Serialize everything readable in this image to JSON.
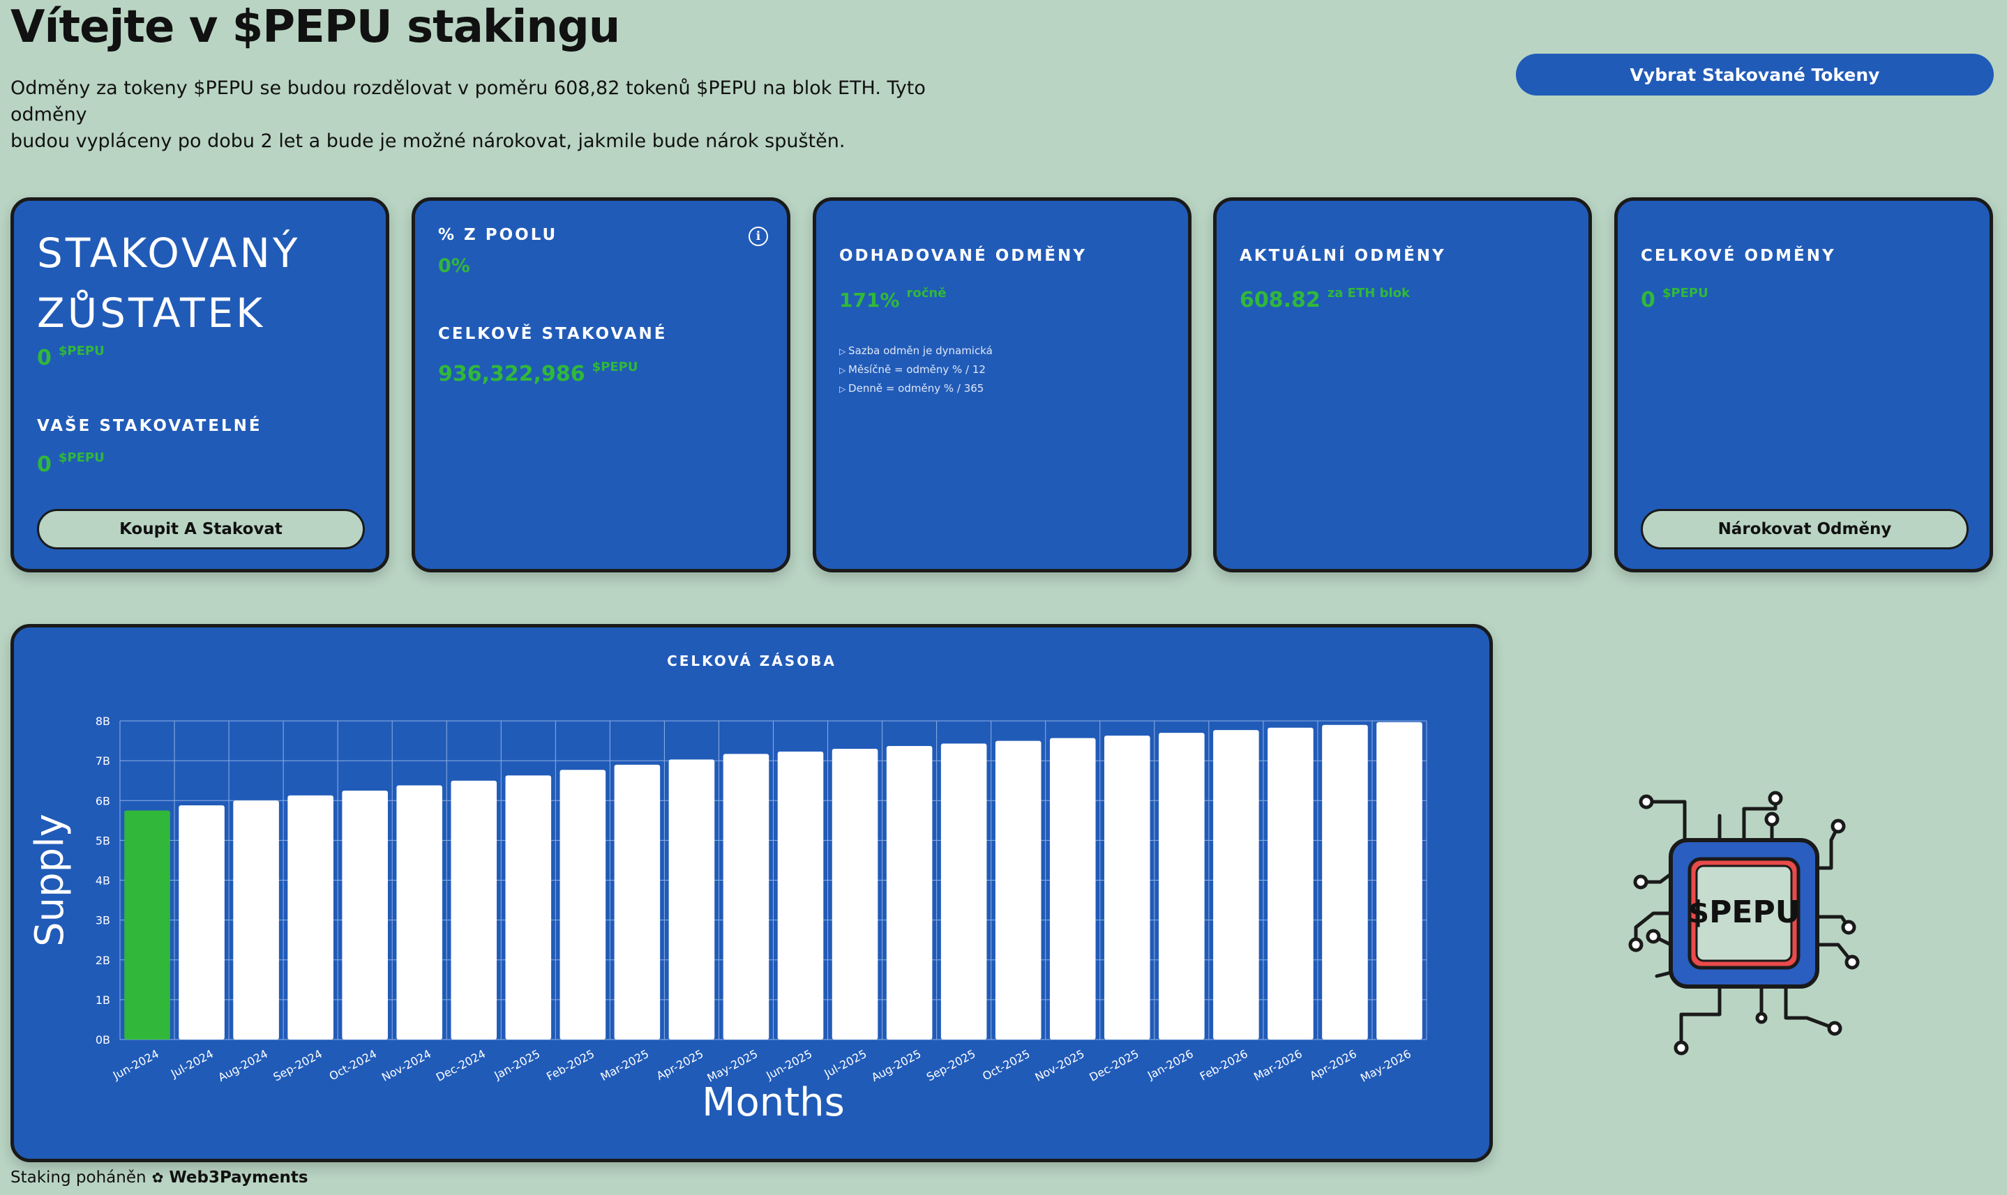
{
  "page": {
    "title": "Vítejte v $PEPU stakingu",
    "intro_line1": "Odměny za tokeny $PEPU se budou rozdělovat v poměru 608,82 tokenů $PEPU na blok ETH. Tyto odměny",
    "intro_line2": "budou vypláceny po dobu 2 let a bude je možné nárokovat, jakmile bude nárok spuštěn.",
    "withdraw_button": "Vybrat Stakované Tokeny"
  },
  "cards": {
    "staked": {
      "label_line1": "STAKOVANÝ",
      "label_line2": "ZŮSTATEK",
      "value": "0",
      "unit": "$PEPU",
      "stakeable_label": "VAŠE STAKOVATELNÉ",
      "stakeable_value": "0",
      "stakeable_unit": "$PEPU",
      "button": "Koupit A Stakovat"
    },
    "pool": {
      "label": "% Z POOLU",
      "value": "0%",
      "info_icon": "i",
      "total_label": "CELKOVĚ STAKOVANÉ",
      "total_value": "936,322,986",
      "total_unit": "$PEPU"
    },
    "estimated": {
      "label": "ODHADOVANÉ ODMĚNY",
      "value": "171%",
      "unit": "ročně",
      "notes": [
        "Sazba odměn je dynamická",
        "Měsíčně = odměny % / 12",
        "Denně = odměny % / 365"
      ]
    },
    "current": {
      "label": "AKTUÁLNÍ ODMĚNY",
      "value": "608.82",
      "unit": "za ETH blok"
    },
    "total": {
      "label": "CELKOVÉ ODMĚNY",
      "value": "0",
      "unit": "$PEPU",
      "button": "Nárokovat Odměny"
    }
  },
  "chart_data": {
    "type": "bar",
    "title": "CELKOVÁ ZÁSOBA",
    "xlabel": "Months",
    "ylabel": "Supply",
    "ylim": [
      0,
      8
    ],
    "yticks": [
      "0B",
      "1B",
      "2B",
      "3B",
      "4B",
      "5B",
      "6B",
      "7B",
      "8B"
    ],
    "categories": [
      "Jun-2024",
      "Jul-2024",
      "Aug-2024",
      "Sep-2024",
      "Oct-2024",
      "Nov-2024",
      "Dec-2024",
      "Jan-2025",
      "Feb-2025",
      "Mar-2025",
      "Apr-2025",
      "May-2025",
      "Jun-2025",
      "Jul-2025",
      "Aug-2025",
      "Sep-2025",
      "Oct-2025",
      "Nov-2025",
      "Dec-2025",
      "Jan-2026",
      "Feb-2026",
      "Mar-2026",
      "Apr-2026",
      "May-2026"
    ],
    "values": [
      5.75,
      5.88,
      6.0,
      6.13,
      6.25,
      6.38,
      6.5,
      6.63,
      6.77,
      6.9,
      7.03,
      7.17,
      7.23,
      7.3,
      7.37,
      7.43,
      7.5,
      7.57,
      7.63,
      7.7,
      7.77,
      7.83,
      7.9,
      7.97
    ],
    "highlight_color": "#31b83a",
    "bar_color": "#ffffff",
    "grid": true
  },
  "chip": {
    "label": "$PEPU"
  },
  "footer": {
    "text": "Staking poháněn",
    "brand": "Web3Payments"
  },
  "colors": {
    "background": "#b9d4c3",
    "card": "#215bb8",
    "accent_green": "#31b83a"
  }
}
